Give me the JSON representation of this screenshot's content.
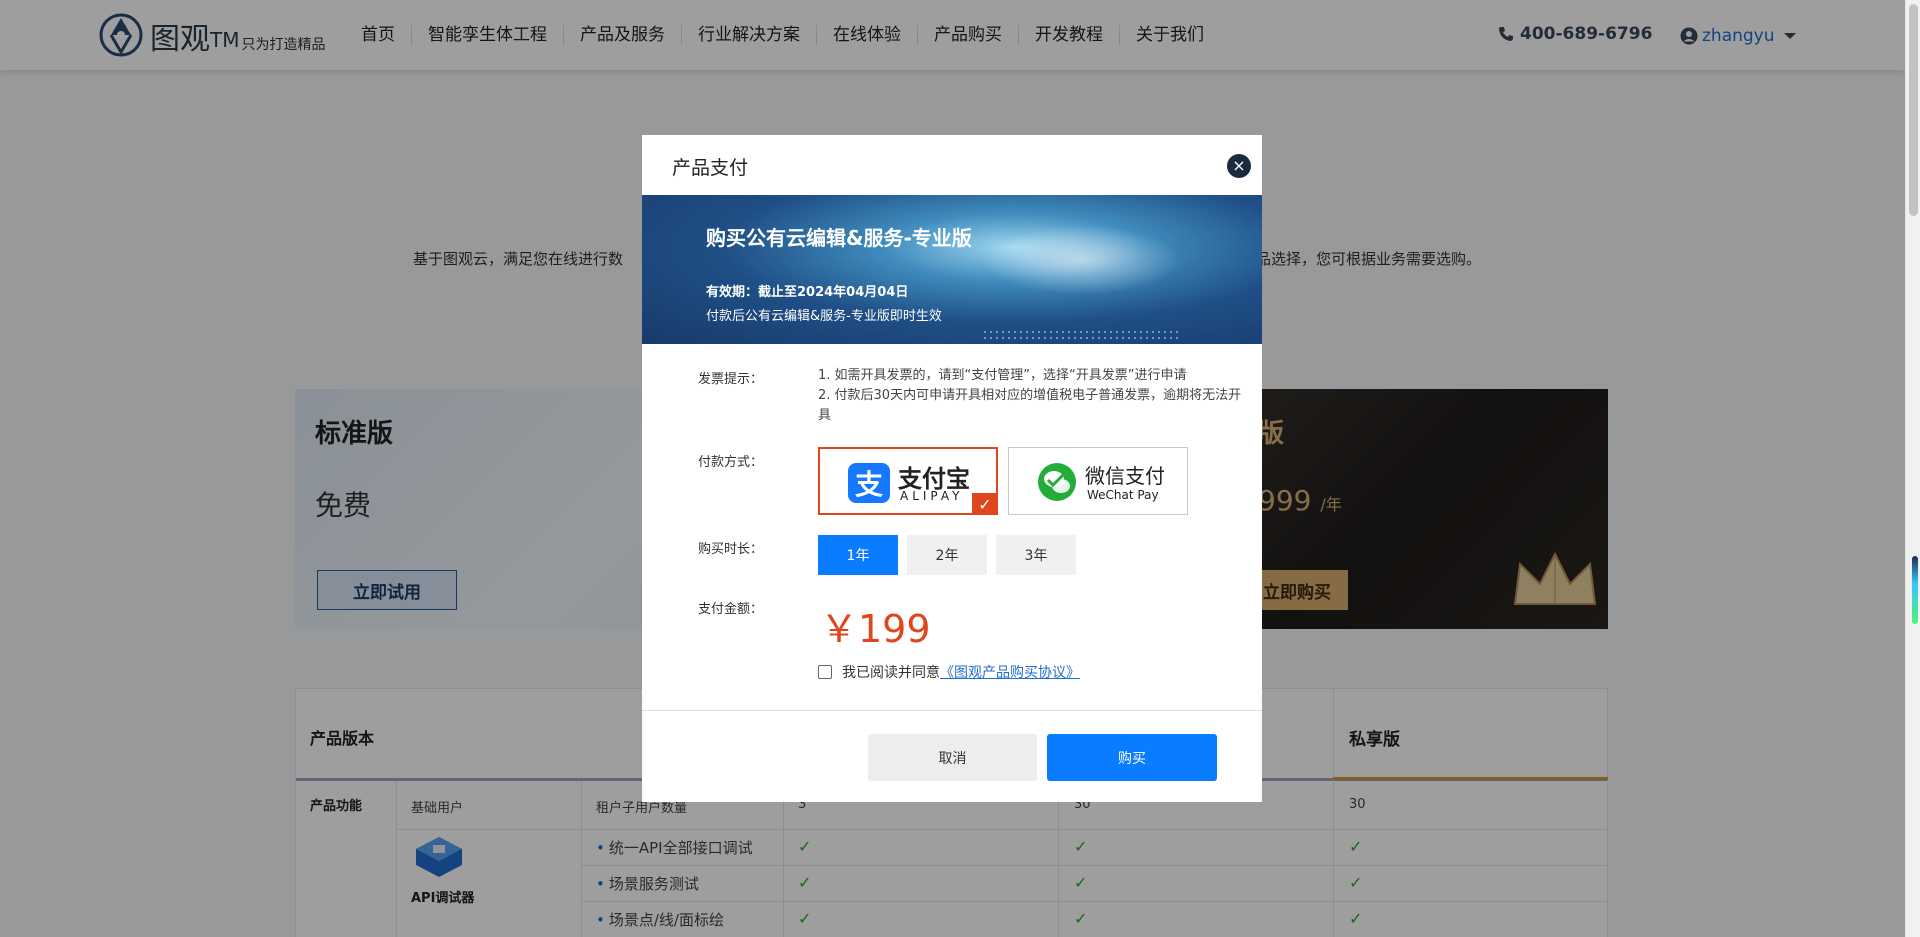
{
  "header": {
    "logo_text": "图观",
    "logo_tm": "TM",
    "slogan": "只为打造精品",
    "nav": [
      "首页",
      "智能孪生体工程",
      "产品及服务",
      "行业解决方案",
      "在线体验",
      "产品购买",
      "开发教程",
      "关于我们"
    ],
    "phone": "400-689-6796",
    "username": "zhangyu"
  },
  "background": {
    "desc_left": "基于图观云，满足您在线进行数",
    "desc_right": "品选择，您可根据业务需要选购。",
    "standard": {
      "title": "标准版",
      "price": "免费",
      "button": "立即试用"
    },
    "pro": {
      "title": "版",
      "price": "999",
      "unit": "/年",
      "button": "立即购买"
    },
    "table": {
      "col_version": "产品版本",
      "col_private": "私享版",
      "category": "产品功能",
      "basic_user": "基础用户",
      "sub_user": "租户子用户数量",
      "counts": [
        "3",
        "30",
        "30"
      ],
      "api_label": "API调试器",
      "features": [
        "统一API全部接口调试",
        "场景服务测试",
        "场景点/线/面标绘"
      ],
      "check": "✓"
    }
  },
  "modal": {
    "title": "产品支付",
    "close": "×",
    "banner": {
      "title": "购买公有云编辑&服务-专业版",
      "valid": "有效期：截止至2024年04月04日",
      "effect": "付款后公有云编辑&服务-专业版即时生效"
    },
    "invoice_label": "发票提示：",
    "invoice_lines": [
      "1. 如需开具发票的，请到“支付管理”，选择“开具发票”进行申请",
      "2. 付款后30天内可申请开具相对应的增值税电子普通发票，逾期将无法开具"
    ],
    "pay_label": "付款方式：",
    "alipay": {
      "cn": "支付宝",
      "en": "ALIPAY",
      "glyph": "支"
    },
    "wechat": {
      "cn": "微信支付",
      "en": "WeChat Pay"
    },
    "duration_label": "购买时长：",
    "durations": [
      "1年",
      "2年",
      "3年"
    ],
    "amount_label": "支付金额：",
    "amount": "￥199",
    "agree_text": "我已阅读并同意",
    "agree_link": "《图观产品购买协议》",
    "cancel": "取消",
    "buy": "购买"
  },
  "colors": {
    "primary": "#0a7cff",
    "accent_red": "#e0461e",
    "gold": "#d9b27a"
  }
}
